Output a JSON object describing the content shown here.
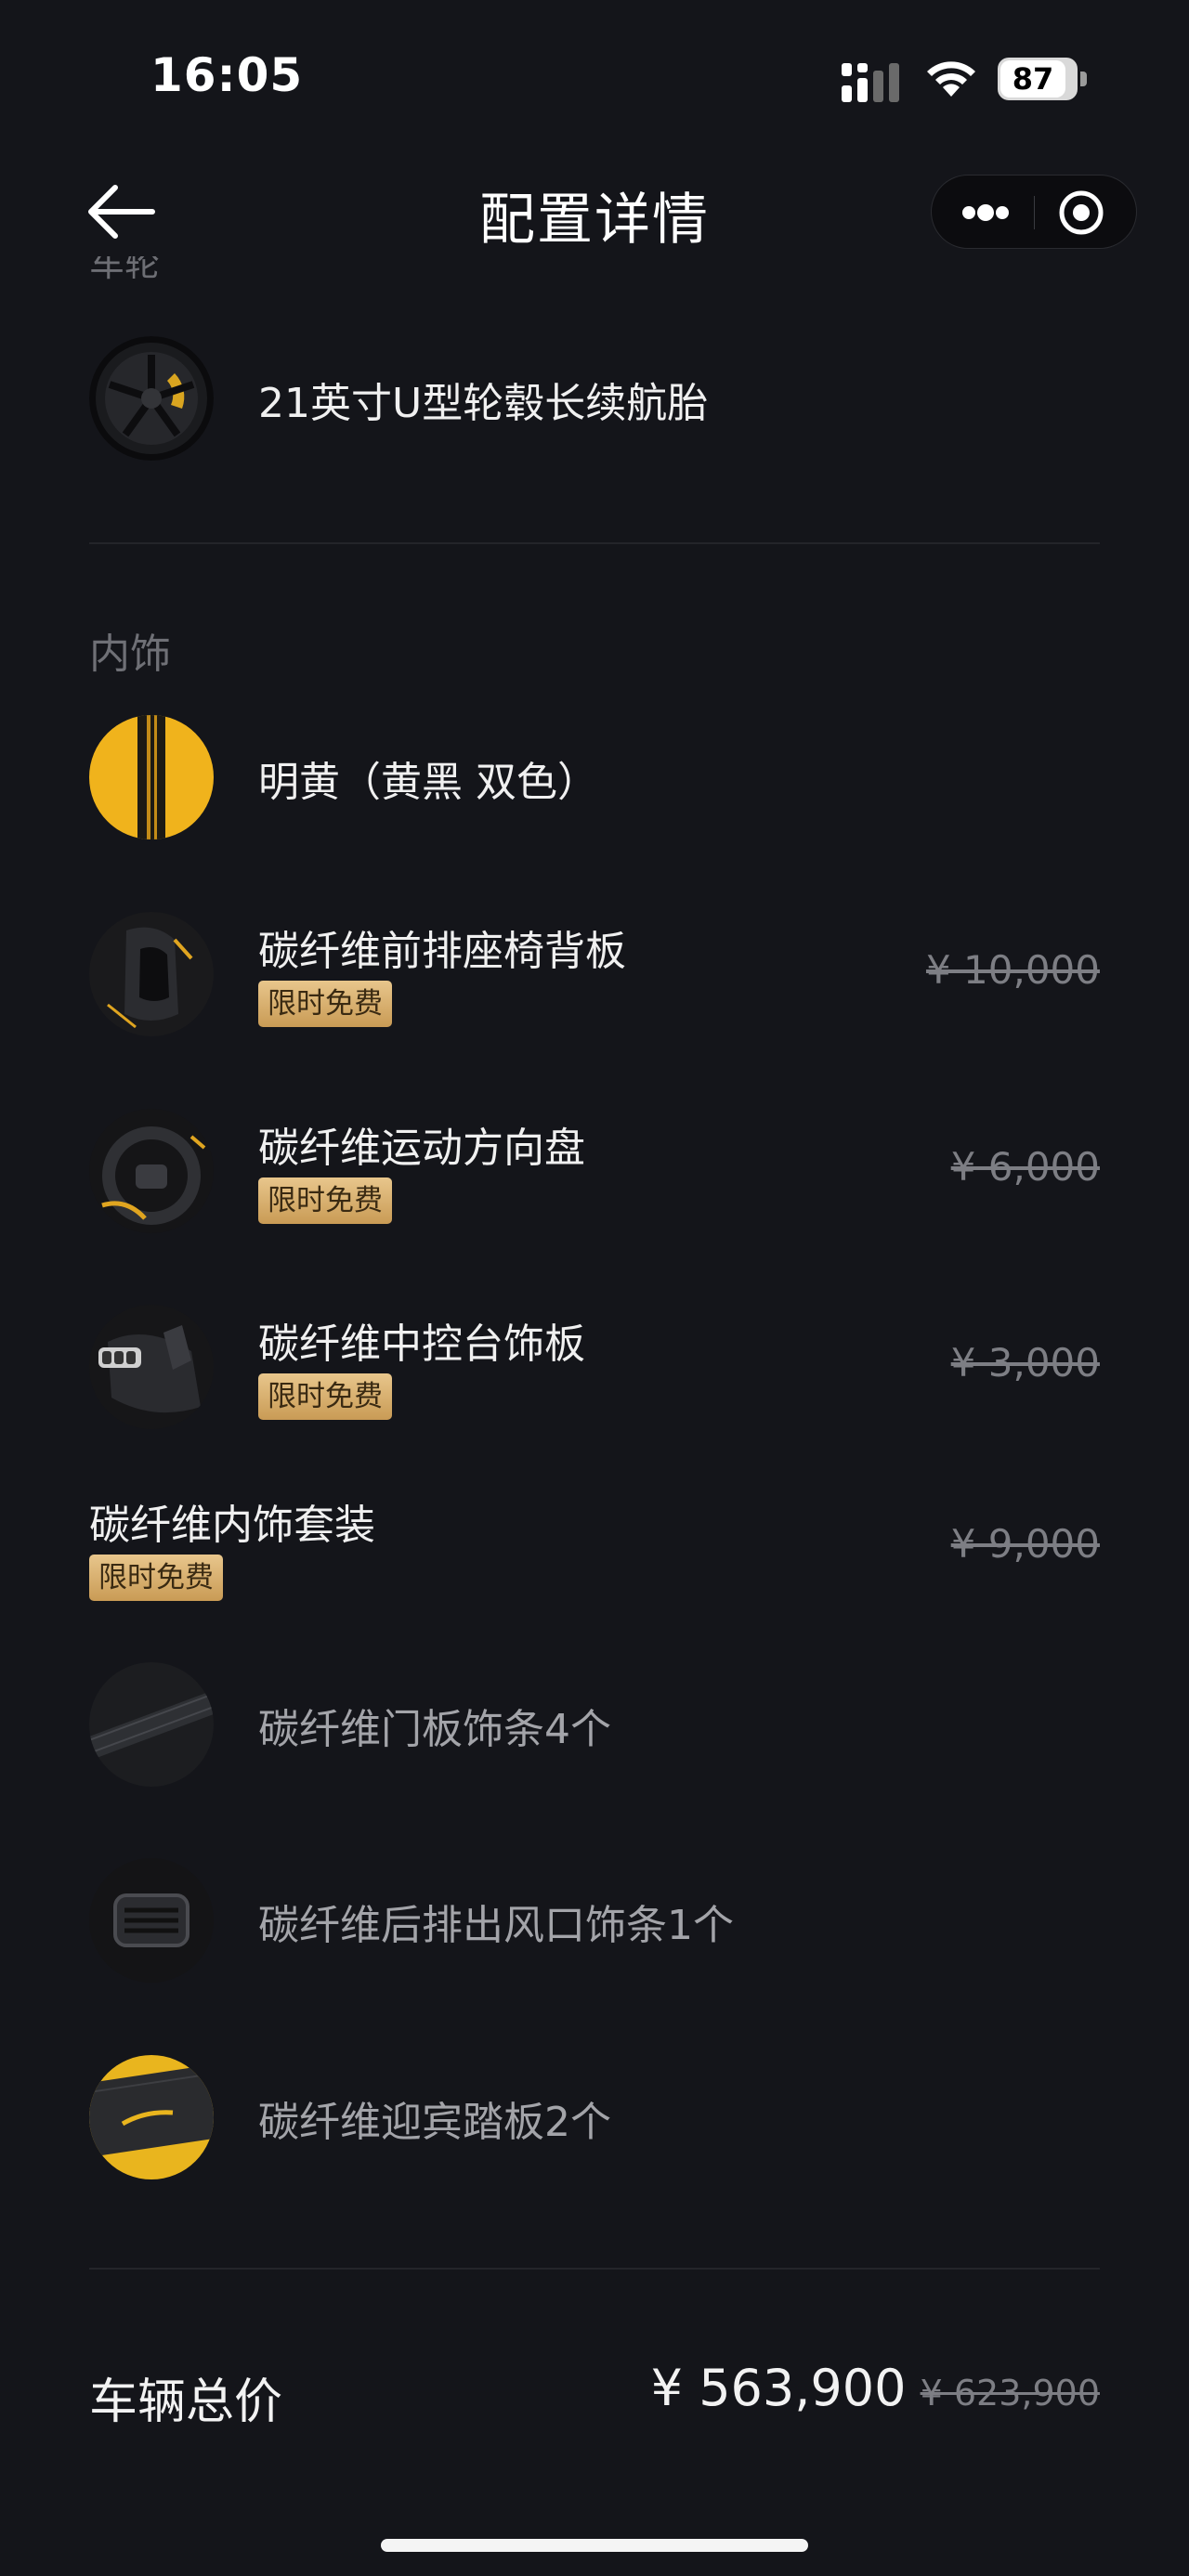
{
  "status_bar": {
    "time": "16:05",
    "battery": "87",
    "battery_level": 0.87
  },
  "nav": {
    "title": "配置详情"
  },
  "wheels": {
    "partial_label": "车轮",
    "item": {
      "name": "21英寸U型轮毂长续航胎"
    }
  },
  "interior": {
    "label": "内饰",
    "color_item": {
      "name": "明黄（黄黑 双色）"
    },
    "items": [
      {
        "name": "碳纤维前排座椅背板",
        "badge": "限时免费",
        "old_price": "¥ 10,000"
      },
      {
        "name": "碳纤维运动方向盘",
        "badge": "限时免费",
        "old_price": "¥ 6,000"
      },
      {
        "name": "碳纤维中控台饰板",
        "badge": "限时免费",
        "old_price": "¥ 3,000"
      }
    ],
    "package": {
      "name": "碳纤维内饰套装",
      "badge": "限时免费",
      "old_price": "¥ 9,000",
      "contents": [
        {
          "name": "碳纤维门板饰条4个"
        },
        {
          "name": "碳纤维后排出风口饰条1个"
        },
        {
          "name": "碳纤维迎宾踏板2个"
        }
      ]
    }
  },
  "total": {
    "label": "车辆总价",
    "price": "¥ 563,900",
    "old_price": "¥ 623,900"
  },
  "colors": {
    "background": "#14151a",
    "badge_gold": "#d6ad6b",
    "accent_yellow": "#f2b31a"
  },
  "icons": [
    "back-arrow-icon",
    "more-dots-icon",
    "target-close-icon",
    "signal-icon",
    "wifi-icon",
    "battery-icon"
  ]
}
